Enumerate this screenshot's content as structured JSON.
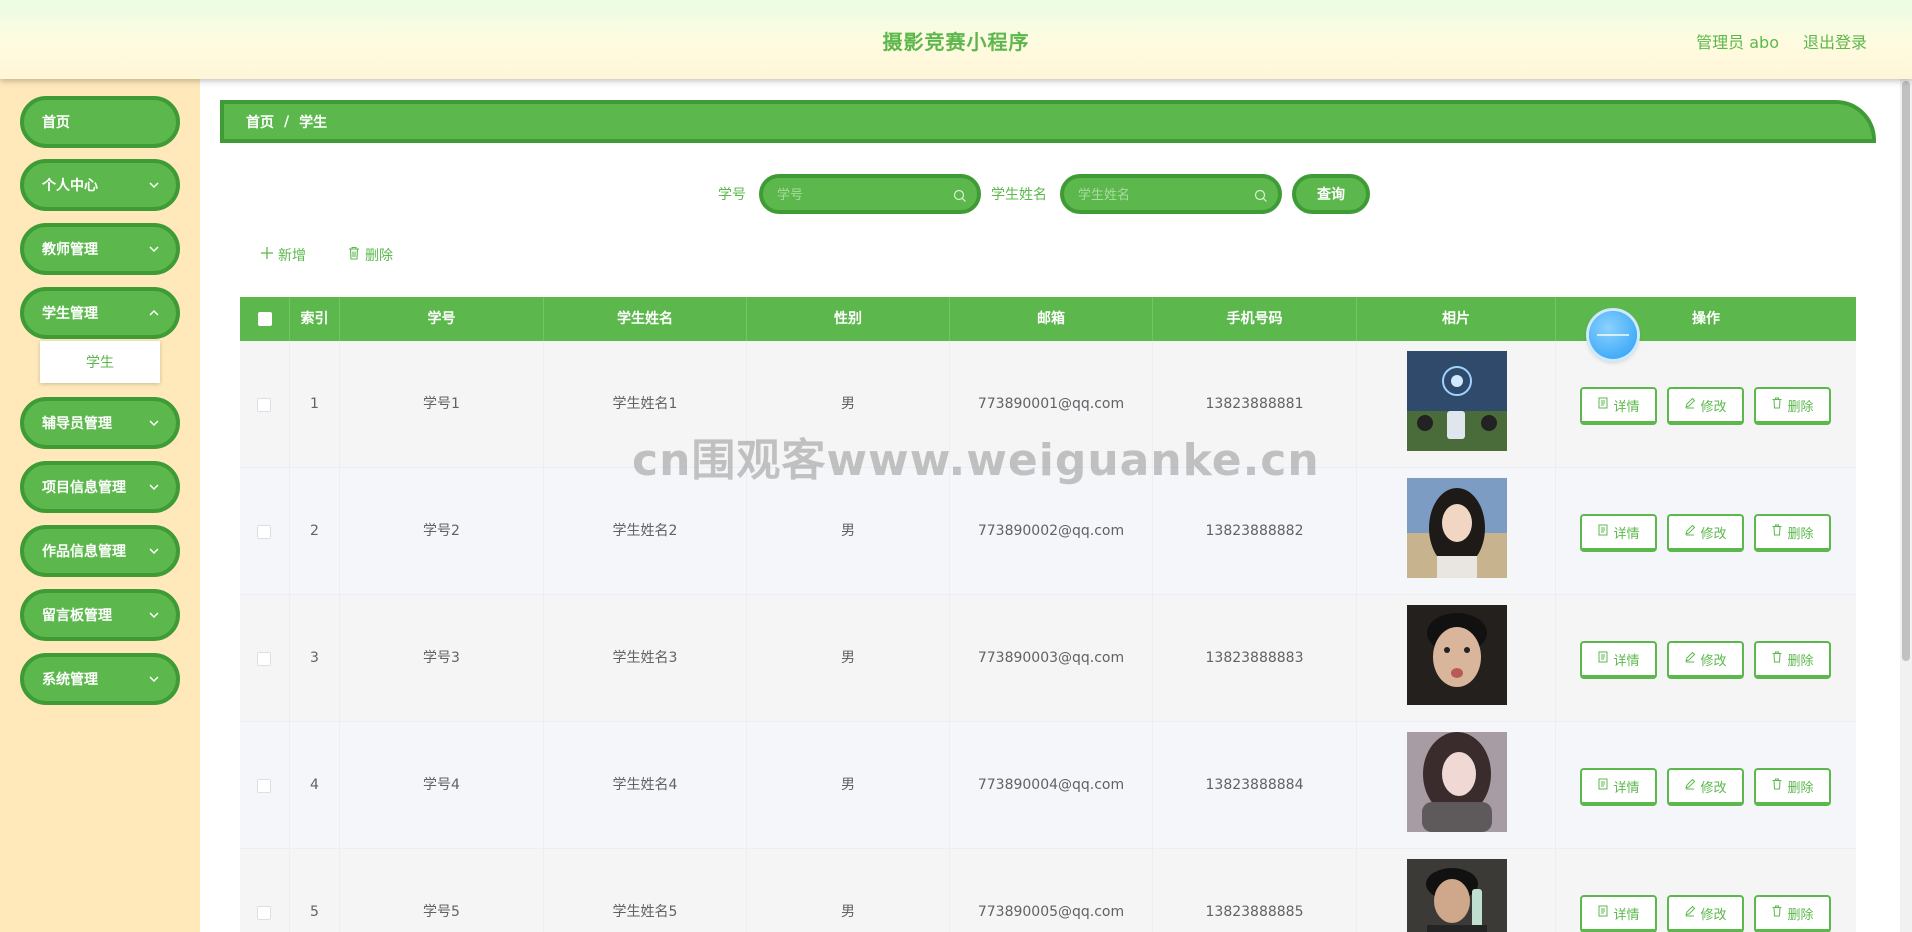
{
  "header": {
    "title": "摄影竞赛小程序",
    "user_label": "管理员 abo",
    "logout_label": "退出登录"
  },
  "sidebar": {
    "items": [
      {
        "label": "首页",
        "has_children": false
      },
      {
        "label": "个人中心",
        "has_children": true
      },
      {
        "label": "教师管理",
        "has_children": true
      },
      {
        "label": "学生管理",
        "has_children": true
      },
      {
        "label": "辅导员管理",
        "has_children": true
      },
      {
        "label": "项目信息管理",
        "has_children": true
      },
      {
        "label": "作品信息管理",
        "has_children": true
      },
      {
        "label": "留言板管理",
        "has_children": true
      },
      {
        "label": "系统管理",
        "has_children": true
      }
    ],
    "submenu": {
      "label": "学生"
    }
  },
  "breadcrumb": {
    "home": "首页",
    "separator": "/",
    "current": "学生"
  },
  "search": {
    "field1_label": "学号",
    "field1_placeholder": "学号",
    "field2_label": "学生姓名",
    "field2_placeholder": "学生姓名",
    "query_label": "查询"
  },
  "actions": {
    "add_label": "新增",
    "delete_label": "删除"
  },
  "table": {
    "columns": [
      "索引",
      "学号",
      "学生姓名",
      "性别",
      "邮箱",
      "手机号码",
      "相片",
      "操作"
    ],
    "rows": [
      {
        "index": "1",
        "student_id": "学号1",
        "name": "学生姓名1",
        "gender": "男",
        "email": "773890001@qq.com",
        "phone": "13823888881"
      },
      {
        "index": "2",
        "student_id": "学号2",
        "name": "学生姓名2",
        "gender": "男",
        "email": "773890002@qq.com",
        "phone": "13823888882"
      },
      {
        "index": "3",
        "student_id": "学号3",
        "name": "学生姓名3",
        "gender": "男",
        "email": "773890003@qq.com",
        "phone": "13823888883"
      },
      {
        "index": "4",
        "student_id": "学号4",
        "name": "学生姓名4",
        "gender": "男",
        "email": "773890004@qq.com",
        "phone": "13823888884"
      },
      {
        "index": "5",
        "student_id": "学号5",
        "name": "学生姓名5",
        "gender": "男",
        "email": "773890005@qq.com",
        "phone": "13823888885"
      }
    ],
    "row_actions": {
      "detail": "详情",
      "edit": "修改",
      "delete": "删除"
    }
  },
  "watermark": "cn围观客www.weiguanke.cn",
  "colors": {
    "primary": "#5cb84c",
    "primary_border": "#3f9b36",
    "sidebar_bg": "#ffe9bb"
  }
}
